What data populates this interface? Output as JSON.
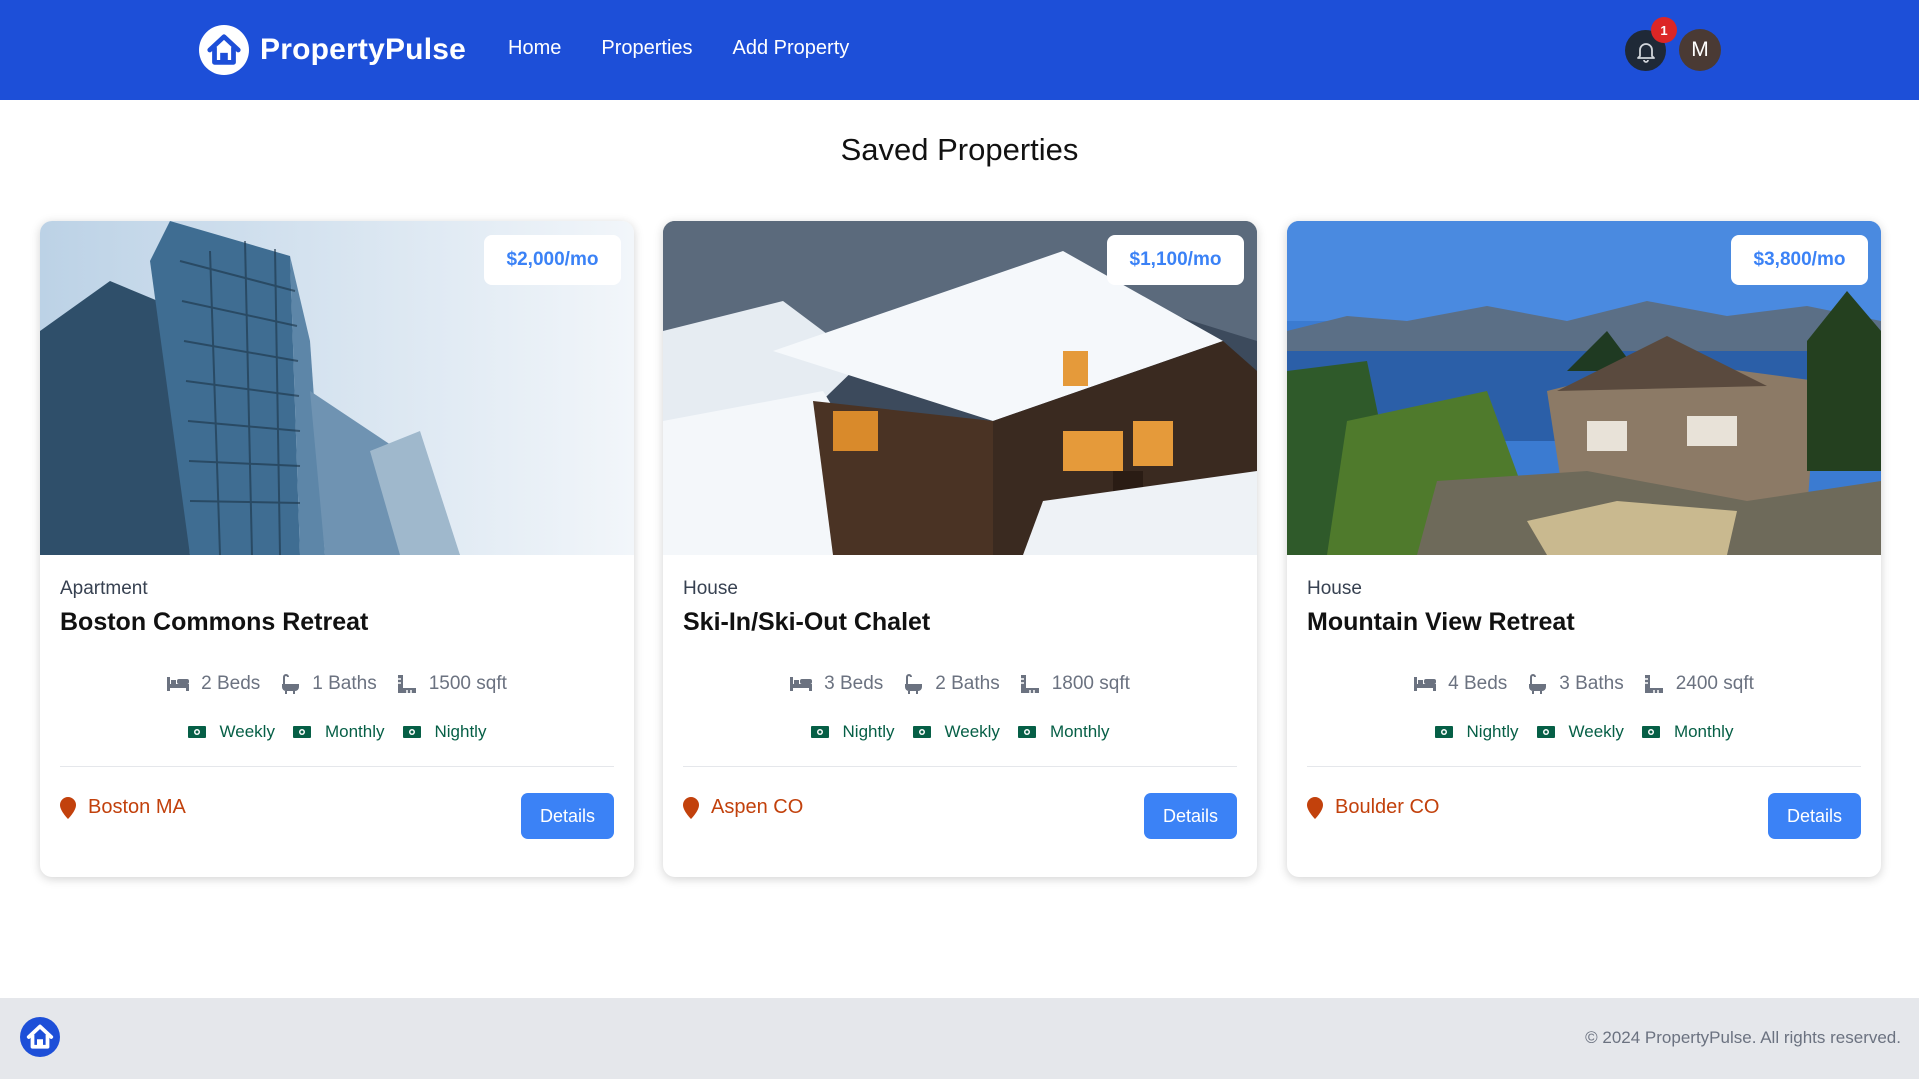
{
  "nav": {
    "brand": "PropertyPulse",
    "links": [
      "Home",
      "Properties",
      "Add Property"
    ],
    "notification_count": "1",
    "avatar_initial": "M"
  },
  "page": {
    "title": "Saved Properties"
  },
  "properties": [
    {
      "price": "$2,000/mo",
      "type": "Apartment",
      "name": "Boston Commons Retreat",
      "beds": "2 Beds",
      "baths": "1 Baths",
      "sqft": "1500 sqft",
      "rates": [
        "Weekly",
        "Monthly",
        "Nightly"
      ],
      "location": "Boston MA",
      "details_label": "Details"
    },
    {
      "price": "$1,100/mo",
      "type": "House",
      "name": "Ski-In/Ski-Out Chalet",
      "beds": "3 Beds",
      "baths": "2 Baths",
      "sqft": "1800 sqft",
      "rates": [
        "Nightly",
        "Weekly",
        "Monthly"
      ],
      "location": "Aspen CO",
      "details_label": "Details"
    },
    {
      "price": "$3,800/mo",
      "type": "House",
      "name": "Mountain View Retreat",
      "beds": "4 Beds",
      "baths": "3 Baths",
      "sqft": "2400 sqft",
      "rates": [
        "Nightly",
        "Weekly",
        "Monthly"
      ],
      "location": "Boulder CO",
      "details_label": "Details"
    }
  ],
  "footer": {
    "copyright": "© 2024 PropertyPulse. All rights reserved."
  },
  "colors": {
    "brand_blue": "#1d4fd8",
    "accent_blue": "#3b82f6",
    "location_orange": "#c2410c",
    "rate_green": "#065f46",
    "notification_red": "#dc2626"
  },
  "icons": [
    "home-logo-icon",
    "bell-icon",
    "bed-icon",
    "bath-icon",
    "ruler-icon",
    "money-icon",
    "map-pin-icon"
  ]
}
